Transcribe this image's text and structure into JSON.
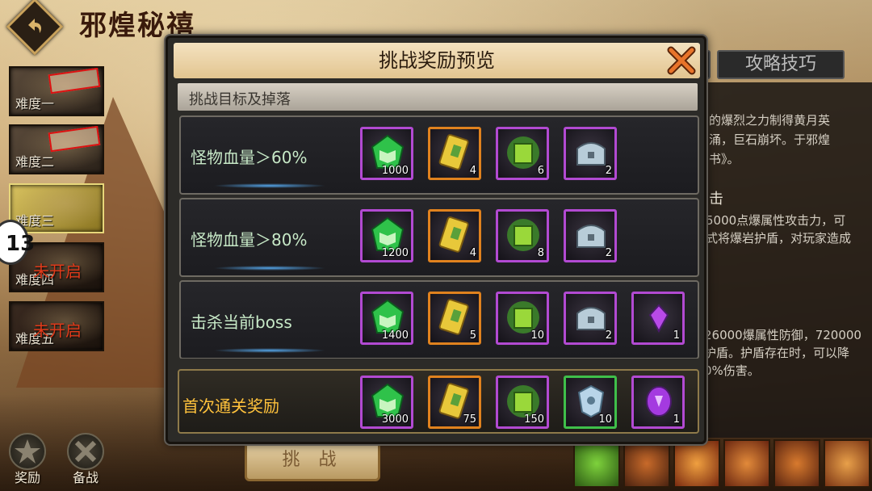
{
  "header": {
    "title": "邪煌秘禧"
  },
  "difficulties": [
    {
      "label": "难度一",
      "stamp": "",
      "status": ""
    },
    {
      "label": "难度二",
      "stamp": "",
      "status": ""
    },
    {
      "label": "难度三",
      "stamp": "",
      "status": ""
    },
    {
      "label": "难度四",
      "stamp": "",
      "status": "未开启"
    },
    {
      "label": "难度五",
      "stamp": "",
      "status": "未开启"
    }
  ],
  "side_badge": "13",
  "bottom": {
    "reward_label": "奖励",
    "prepare_label": "备战",
    "challenge_label": "挑 战"
  },
  "tabs": {
    "strategy_label": "攻略技巧"
  },
  "right_panel": {
    "lines1": [
      "的爆烈之力制得黄月英",
      "涌，巨石崩坏。于邪煌",
      "书》。"
    ],
    "section_title": "击",
    "lines2": [
      "5000点爆属性攻击力，可",
      "式将爆岩护盾，对玩家造成"
    ],
    "lines3": [
      "26000爆属性防御，720000",
      "护盾。护盾存在时，可以降",
      "0%伤害。"
    ]
  },
  "modal": {
    "title": "挑战奖励预览",
    "subheader": "挑战目标及掉落",
    "rows": [
      {
        "condition": "怪物血量＞60%",
        "items": [
          {
            "icon": "green-book-gem-icon",
            "qty": "1000",
            "rarity": "purple"
          },
          {
            "icon": "gold-ticket-icon",
            "qty": "4",
            "rarity": "orange"
          },
          {
            "icon": "green-scroll-icon",
            "qty": "6",
            "rarity": "purple"
          },
          {
            "icon": "silver-chest-icon",
            "qty": "2",
            "rarity": "purple"
          }
        ]
      },
      {
        "condition": "怪物血量＞80%",
        "items": [
          {
            "icon": "green-book-gem-icon",
            "qty": "1200",
            "rarity": "purple"
          },
          {
            "icon": "gold-ticket-icon",
            "qty": "4",
            "rarity": "orange"
          },
          {
            "icon": "green-scroll-icon",
            "qty": "8",
            "rarity": "purple"
          },
          {
            "icon": "silver-chest-icon",
            "qty": "2",
            "rarity": "purple"
          }
        ]
      },
      {
        "condition": "击杀当前boss",
        "items": [
          {
            "icon": "green-book-gem-icon",
            "qty": "1400",
            "rarity": "purple"
          },
          {
            "icon": "gold-ticket-icon",
            "qty": "5",
            "rarity": "orange"
          },
          {
            "icon": "green-scroll-icon",
            "qty": "10",
            "rarity": "purple"
          },
          {
            "icon": "silver-chest-icon",
            "qty": "2",
            "rarity": "purple"
          },
          {
            "icon": "purple-crystal-icon",
            "qty": "1",
            "rarity": "purple"
          }
        ]
      }
    ],
    "first_clear": {
      "condition": "首次通关奖励",
      "items": [
        {
          "icon": "green-book-gem-icon",
          "qty": "3000",
          "rarity": "purple"
        },
        {
          "icon": "gold-ticket-icon",
          "qty": "75",
          "rarity": "orange"
        },
        {
          "icon": "green-scroll-icon",
          "qty": "150",
          "rarity": "purple"
        },
        {
          "icon": "silver-shield-icon",
          "qty": "10",
          "rarity": "green"
        },
        {
          "icon": "purple-crystal-egg-icon",
          "qty": "1",
          "rarity": "purple"
        }
      ]
    }
  },
  "colors": {
    "accent_gold": "#ffc23c",
    "rarity_purple": "#b24ad2",
    "rarity_orange": "#e0821e",
    "rarity_green": "#3fbf4a",
    "locked_red": "#e03a1a"
  }
}
